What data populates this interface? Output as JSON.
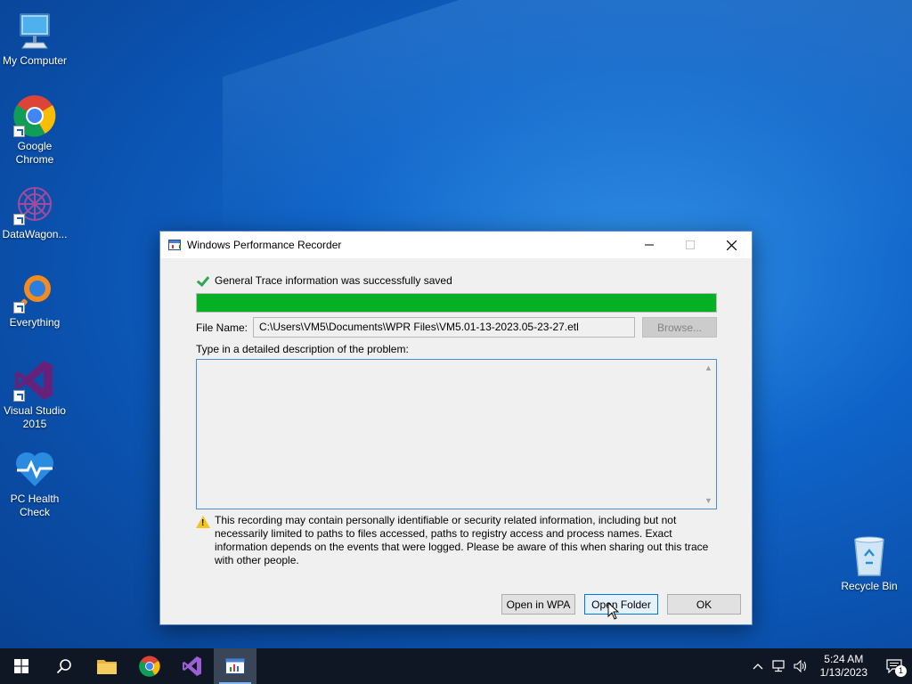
{
  "desktop": {
    "icons": [
      {
        "label": "My Computer"
      },
      {
        "label": "Google\nChrome"
      },
      {
        "label": "DataWagon..."
      },
      {
        "label": "Everything"
      },
      {
        "label": "Visual Studio\n2015"
      },
      {
        "label": "PC Health\nCheck"
      },
      {
        "label": "Recycle Bin"
      }
    ]
  },
  "dialog": {
    "title": "Windows Performance Recorder",
    "status_message": "General Trace information was successfully saved",
    "progress": 1.0,
    "file_name_label": "File Name:",
    "file_name_value": "C:\\Users\\VM5\\Documents\\WPR Files\\VM5.01-13-2023.05-23-27.etl",
    "browse_label": "Browse...",
    "description_label": "Type in a detailed description of the problem:",
    "description_value": "",
    "warning_text": "This recording may contain personally identifiable or security related information, including but not necessarily limited to paths to files accessed, paths to registry access and process names. Exact information depends on the events that were logged. Please be aware of this when sharing out this trace with other people.",
    "buttons": {
      "open_wpa": "Open in WPA",
      "open_folder": "Open Folder",
      "ok": "OK"
    },
    "colors": {
      "progress_fill": "#06b025",
      "check": "#2fa84f"
    }
  },
  "taskbar": {
    "clock_time": "5:24 AM",
    "clock_date": "1/13/2023",
    "notification_count": "1",
    "pinned": [
      "windows-start-icon",
      "search-icon",
      "file-explorer-icon",
      "chrome-icon",
      "visual-studio-icon",
      "wpr-icon"
    ]
  }
}
